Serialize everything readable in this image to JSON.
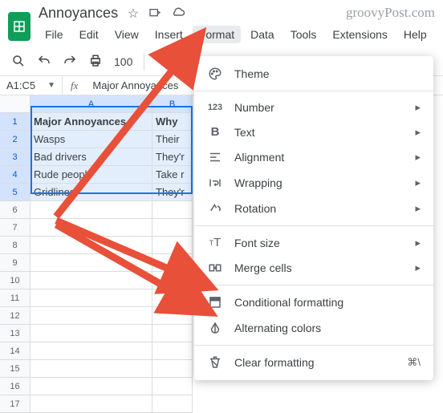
{
  "doc": {
    "title": "Annoyances"
  },
  "menubar": [
    "File",
    "Edit",
    "View",
    "Insert",
    "Format",
    "Data",
    "Tools",
    "Extensions",
    "Help"
  ],
  "toolbar": {
    "zoom": "100"
  },
  "namebox": "A1:C5",
  "formula": "Major Annoyances",
  "columns": [
    "A",
    "B"
  ],
  "rows": [
    "1",
    "2",
    "3",
    "4",
    "5",
    "6",
    "7",
    "8",
    "9",
    "10",
    "11",
    "12",
    "13",
    "14",
    "15",
    "16",
    "17"
  ],
  "cells": {
    "A1": "Major Annoyances",
    "B1": "Why",
    "A2": "Wasps",
    "B2": "Their",
    "A3": "Bad drivers",
    "B3": "They'r",
    "A4": "Rude people",
    "B4": "Take r",
    "A5": "Gridlines",
    "B5": "They'r"
  },
  "dropdown": [
    {
      "k": "theme",
      "icon": "palette",
      "label": "Theme",
      "sub": false
    },
    {
      "sep": true
    },
    {
      "k": "number",
      "icon": "123",
      "label": "Number",
      "sub": true
    },
    {
      "k": "text",
      "icon": "bold",
      "label": "Text",
      "sub": true
    },
    {
      "k": "alignment",
      "icon": "align",
      "label": "Alignment",
      "sub": true
    },
    {
      "k": "wrapping",
      "icon": "wrap",
      "label": "Wrapping",
      "sub": true
    },
    {
      "k": "rotation",
      "icon": "rotate",
      "label": "Rotation",
      "sub": true
    },
    {
      "sep": true
    },
    {
      "k": "fontsize",
      "icon": "fontsize",
      "label": "Font size",
      "sub": true
    },
    {
      "k": "merge",
      "icon": "merge",
      "label": "Merge cells",
      "sub": true
    },
    {
      "sep": true
    },
    {
      "k": "conditional",
      "icon": "conditional",
      "label": "Conditional formatting",
      "sub": false
    },
    {
      "k": "alternating",
      "icon": "alternating",
      "label": "Alternating colors",
      "sub": false
    },
    {
      "sep": true
    },
    {
      "k": "clear",
      "icon": "clear",
      "label": "Clear formatting",
      "sub": false,
      "shortcut": "⌘\\"
    }
  ],
  "watermark": "groovyPost.com"
}
